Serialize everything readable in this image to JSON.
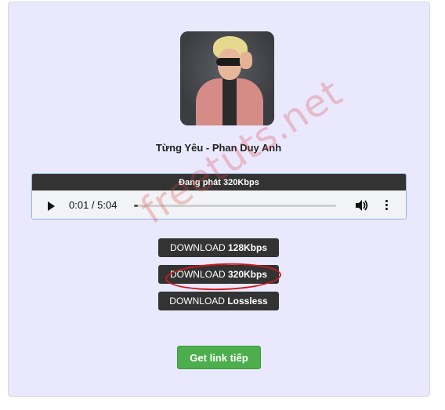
{
  "song": {
    "title": "Từng Yêu - Phan Duy Anh"
  },
  "player": {
    "header": "Đang phát 320Kbps",
    "time": "0:01 / 5:04",
    "progress_fraction": 0.02
  },
  "downloads": [
    {
      "prefix": "DOWNLOAD ",
      "quality": "128Kbps"
    },
    {
      "prefix": "DOWNLOAD ",
      "quality": "320Kbps"
    },
    {
      "prefix": "DOWNLOAD ",
      "quality": "Lossless"
    }
  ],
  "get_link_label": "Get link tiếp",
  "watermark": "freetuts.net",
  "colors": {
    "card_bg": "#e9e8fd",
    "button_dark": "#333333",
    "button_green": "#4cae4c",
    "highlight_circle": "#d11a1a"
  }
}
